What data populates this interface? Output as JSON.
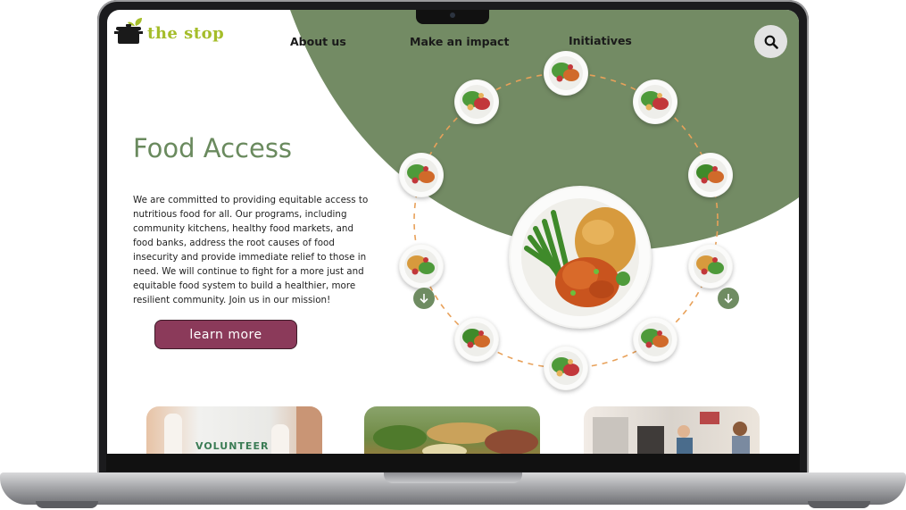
{
  "brand": {
    "name": "the stop",
    "logo_icon": "pot-with-sprout-icon",
    "color": "#a5bd2a"
  },
  "nav": {
    "items": [
      {
        "label": "About us"
      },
      {
        "label": "Make an impact"
      },
      {
        "label": "Initiatives"
      }
    ],
    "search_icon": "search-icon"
  },
  "hero": {
    "title": "Food Access",
    "body": "We are committed to providing equitable access to nutritious food for all. Our programs, including community kitchens, healthy food markets, and food banks, address the root causes of food insecurity and provide immediate relief to those in need. We will continue to fight for a more just and equitable food system to build a healthier, more resilient community. Join us in our mission!",
    "cta_label": "learn more"
  },
  "carousel": {
    "prev_icon": "arrow-down-icon",
    "next_icon": "arrow-down-icon",
    "dish_count": 10
  },
  "cards": [
    {
      "caption": "VOLUNTEER"
    },
    {
      "caption": ""
    },
    {
      "caption": ""
    }
  ],
  "colors": {
    "accent_green": "#6f8c62",
    "title_green": "#6a8a5e",
    "cta": "#8b3a5a",
    "ring_dash": "#e8a15a"
  }
}
